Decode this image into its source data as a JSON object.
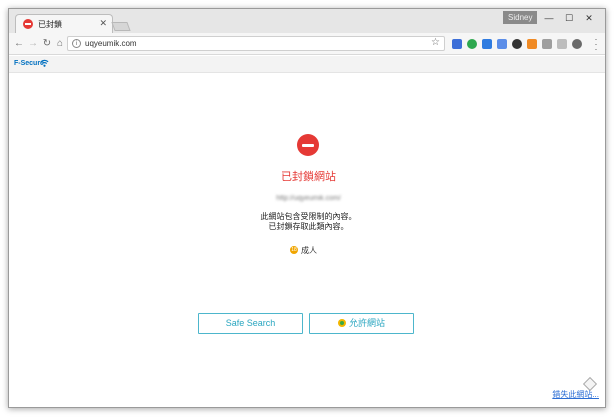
{
  "tab": {
    "title": "已封鎖"
  },
  "window": {
    "user_badge": "Sidney"
  },
  "address_bar": {
    "url": "uqyeumik.com"
  },
  "security_bar": {
    "brand": "F-Secure"
  },
  "page": {
    "heading": "已封鎖網站",
    "blocked_url": "http://uqyeumik.com/",
    "message_line1": "此網站包含受限制的內容。",
    "message_line2": "已封鎖存取此類內容。",
    "category": "成人",
    "safe_search_label": "Safe Search",
    "allow_label": "允許網站",
    "report_link": "錯失此網站..."
  },
  "colors": {
    "accent_red": "#e53935",
    "button_border": "#4db6cc",
    "link_blue": "#2b6dd4"
  }
}
